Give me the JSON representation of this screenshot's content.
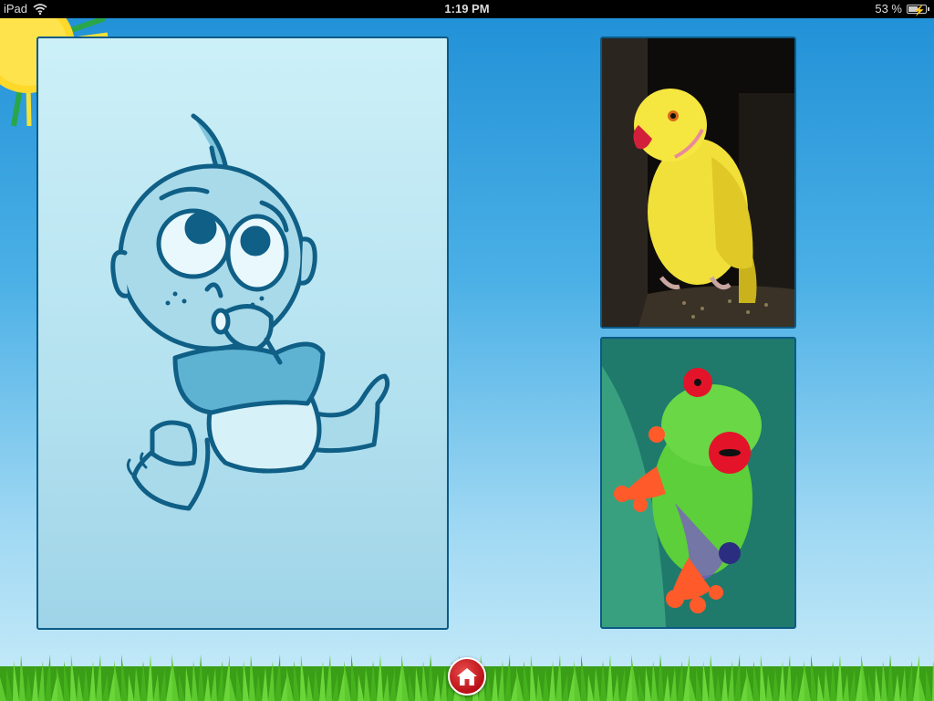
{
  "status_bar": {
    "device": "iPad",
    "time": "1:19 PM",
    "battery": "53 %",
    "battery_level": 0.53
  },
  "icons": {
    "wifi": "wifi-icon",
    "battery": "battery-charging-icon",
    "home": "home-icon"
  },
  "colors": {
    "sky_top": "#1f8fd6",
    "panel_border": "#0c5a86",
    "home_button": "#c8141c",
    "grass": "#3fae1f"
  }
}
